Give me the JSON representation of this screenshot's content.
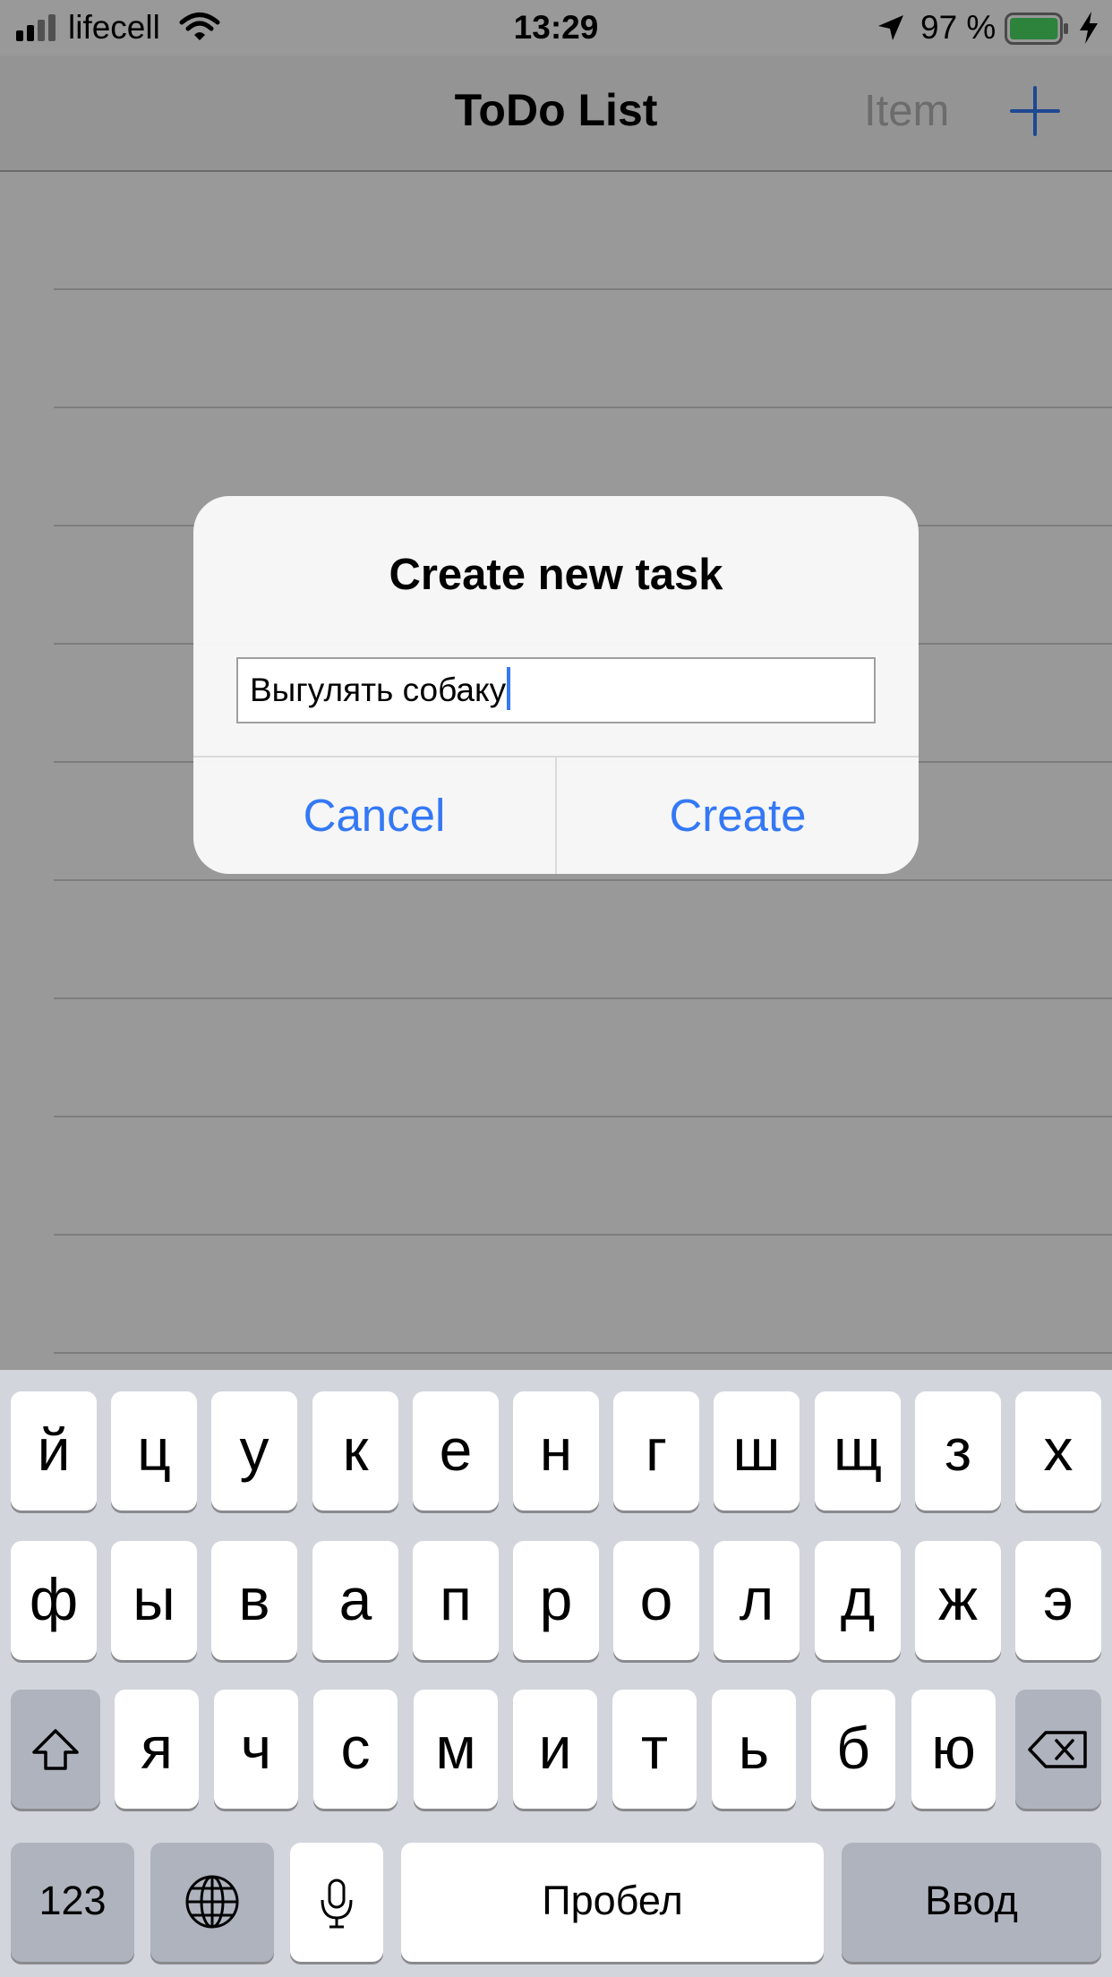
{
  "status_bar": {
    "carrier": "lifecell",
    "time": "13:29",
    "battery_percent": "97 %",
    "battery_level": 0.97,
    "signal_bars": 4,
    "icons": [
      "signal-bars-icon",
      "wifi-icon",
      "location-arrow-icon",
      "battery-icon",
      "charging-bolt-icon"
    ]
  },
  "nav_bar": {
    "title": "ToDo List",
    "item_button": "Item",
    "add_icon": "plus-icon"
  },
  "list": {
    "empty_rows": 10
  },
  "alert": {
    "title": "Create new task",
    "field_value": "Выгулять собаку",
    "cancel_label": "Cancel",
    "create_label": "Create"
  },
  "keyboard": {
    "row1": [
      "й",
      "ц",
      "у",
      "к",
      "е",
      "н",
      "г",
      "ш",
      "щ",
      "з",
      "х"
    ],
    "row2": [
      "ф",
      "ы",
      "в",
      "а",
      "п",
      "р",
      "о",
      "л",
      "д",
      "ж",
      "э"
    ],
    "row3": [
      "я",
      "ч",
      "с",
      "м",
      "и",
      "т",
      "ь",
      "б",
      "ю"
    ],
    "numbers_key": "123",
    "space_key": "Пробел",
    "return_key": "Ввод",
    "icons": [
      "shift-icon",
      "backspace-icon",
      "globe-icon",
      "microphone-icon"
    ]
  },
  "colors": {
    "accent": "#3478f6",
    "battery_fill": "#4cd964",
    "keyboard_bg": "#d2d5dc",
    "dark_key": "#aeb3be"
  }
}
